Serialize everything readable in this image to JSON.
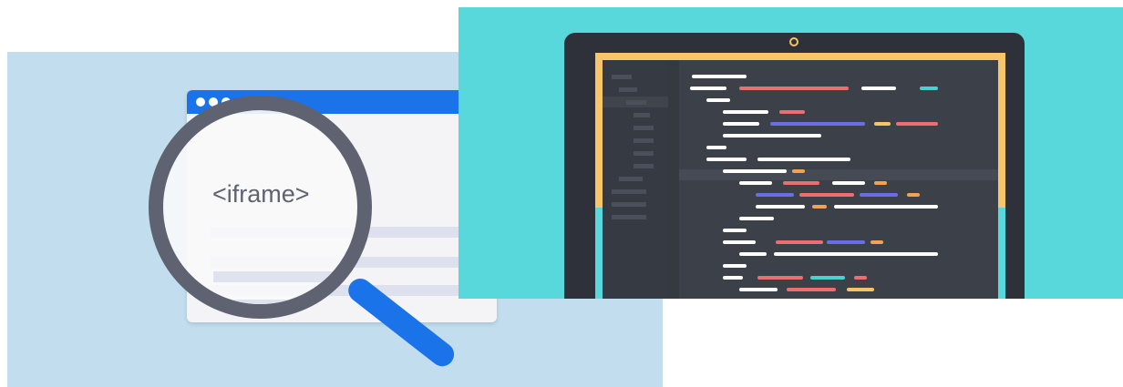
{
  "left_illustration": {
    "iframe_text": "<iframe>",
    "colors": {
      "background": "#c1ddee",
      "browser_bar": "#1a73e8",
      "magnifier": "#5f6271",
      "handle": "#1a73e8"
    },
    "icons": [
      "browser-window-icon",
      "magnifying-glass-icon"
    ]
  },
  "right_illustration": {
    "colors": {
      "background": "#58d8db",
      "laptop": "#2e3139",
      "screen_top": "#f8c66a",
      "editor": "#3c4049"
    },
    "icons": [
      "laptop-icon",
      "code-editor-icon"
    ]
  }
}
